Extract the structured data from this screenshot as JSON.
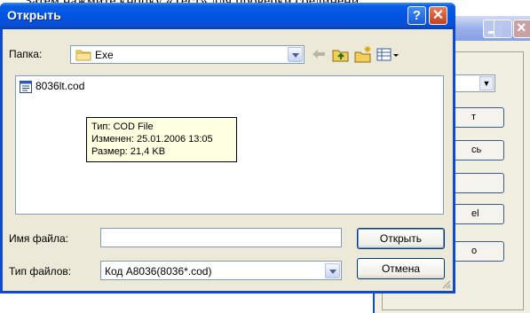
{
  "document": {
    "text": "Затем нажмите кнопку «Тест» для проверки соединени"
  },
  "background_window": {
    "buttons": [
      {
        "label": "т"
      },
      {
        "label": "сь"
      },
      {
        "label": ""
      },
      {
        "label": "el"
      },
      {
        "label": "о"
      }
    ]
  },
  "dialog": {
    "title": "Открыть",
    "help_glyph": "?",
    "close_glyph": "✕",
    "folder": {
      "label": "Папка:",
      "value": "Exe"
    },
    "toolbar": {
      "icons": [
        "back-icon",
        "up-folder-icon",
        "new-folder-icon",
        "view-menu-icon"
      ]
    },
    "files": [
      {
        "name": "8036lt.cod",
        "icon": "cod-file-icon"
      }
    ],
    "tooltip": {
      "type_line": "Тип: COD File",
      "modified_line": "Изменен: 25.01.2006 13:05",
      "size_line": "Размер: 21,4 KB"
    },
    "filename": {
      "label": "Имя файла:",
      "value": ""
    },
    "filetype": {
      "label": "Тип файлов:",
      "value": "Код A8036(8036*.cod)"
    },
    "open_button": "Открыть",
    "cancel_button": "Отмена"
  },
  "colors": {
    "titlebar": "#0054e3",
    "dialog_face": "#ece9d8",
    "tooltip_bg": "#ffffe1"
  }
}
